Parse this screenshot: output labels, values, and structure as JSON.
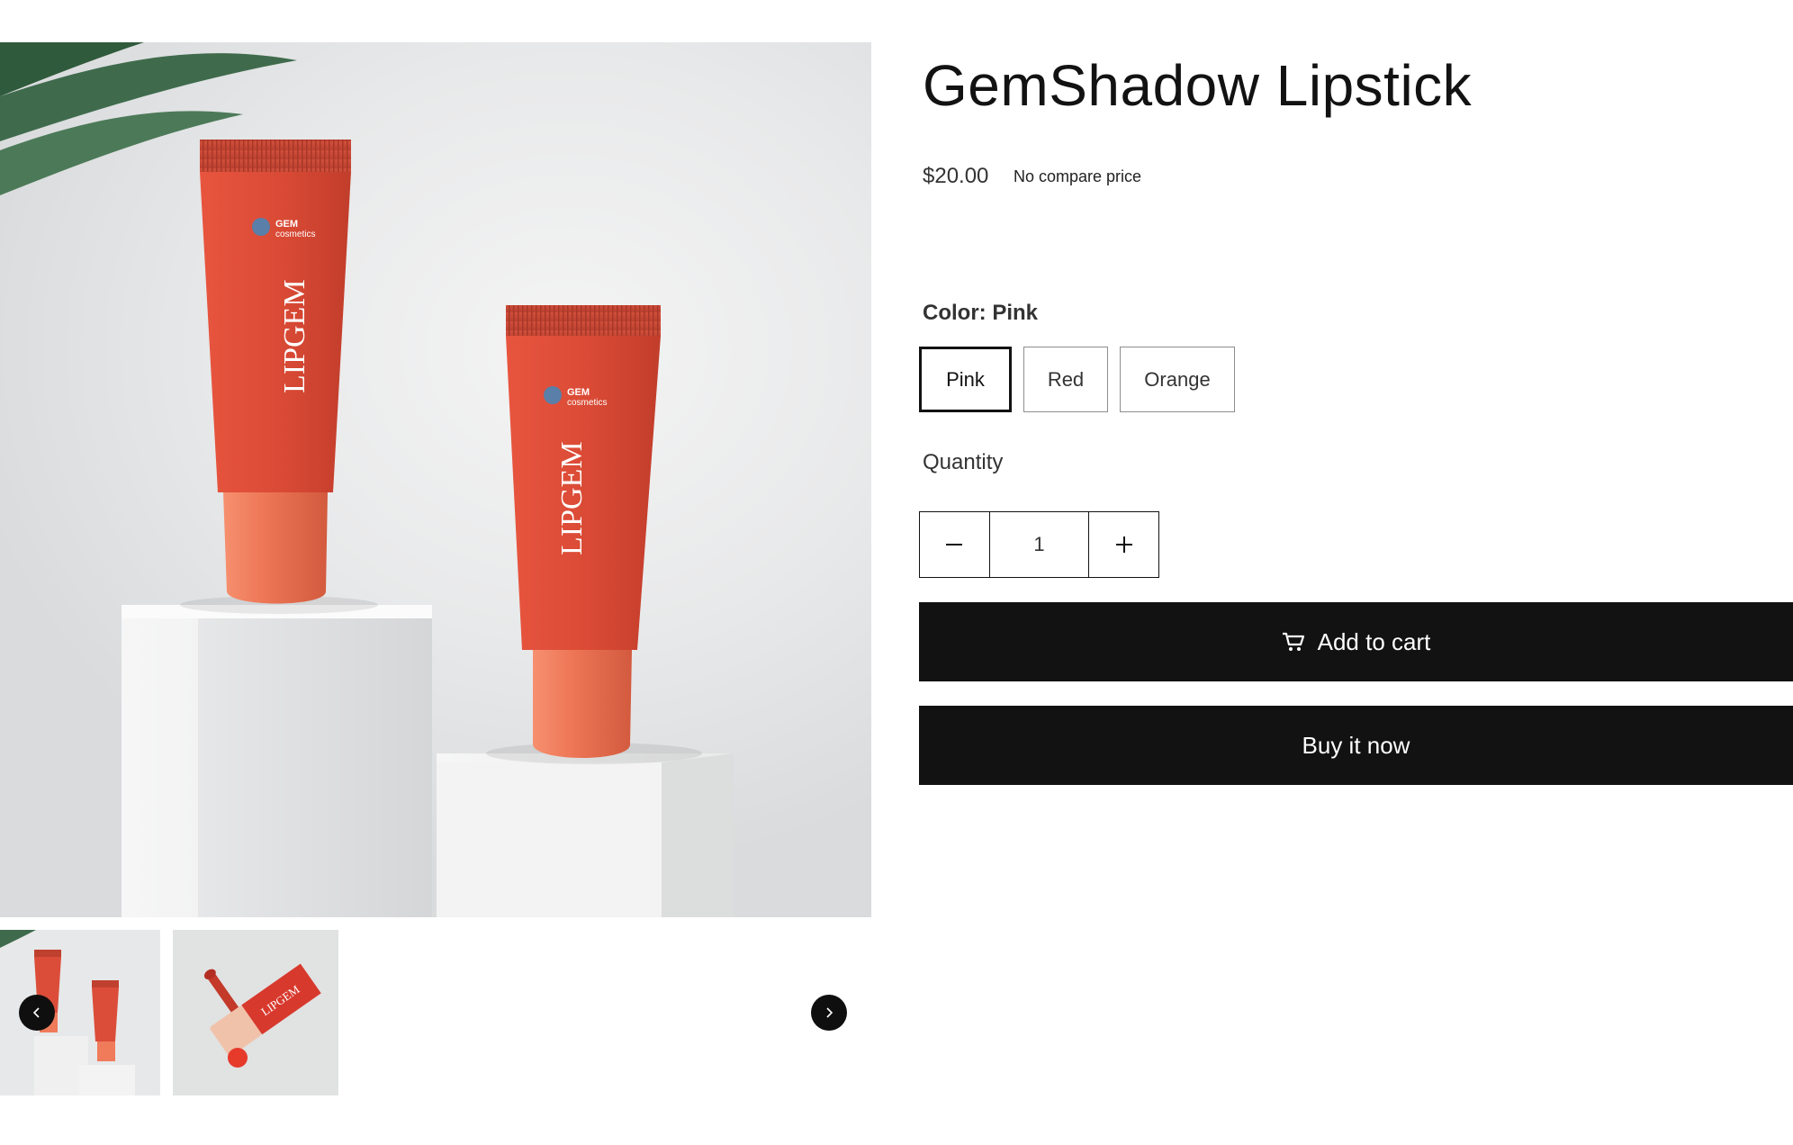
{
  "product": {
    "title": "GemShadow Lipstick",
    "price": "$20.00",
    "compare_price": "No compare price"
  },
  "gallery": {
    "main_image": {
      "brand": "GEM",
      "brand_sub": "cosmetics",
      "product_name": "LIPGEM"
    },
    "thumbnails": [
      {
        "name": "LIPGEM tubes on podium"
      },
      {
        "name": "LIPGEM liquid lipstick",
        "label": "LIPGEM"
      }
    ],
    "prev_icon": "chevron-left-icon",
    "next_icon": "chevron-right-icon"
  },
  "options": {
    "color_label": "Color: Pink",
    "colors": [
      {
        "label": "Pink",
        "selected": true
      },
      {
        "label": "Red",
        "selected": false
      },
      {
        "label": "Orange",
        "selected": false
      }
    ]
  },
  "quantity": {
    "label": "Quantity",
    "value": "1",
    "minus_icon": "minus-icon",
    "plus_icon": "plus-icon"
  },
  "actions": {
    "add_to_cart": "Add to cart",
    "cart_icon": "cart-icon",
    "buy_now": "Buy it now"
  },
  "colors": {
    "button_bg": "#121212",
    "tube": "#e0533f",
    "cap": "#ef7b5b",
    "background": "#ffffff"
  }
}
